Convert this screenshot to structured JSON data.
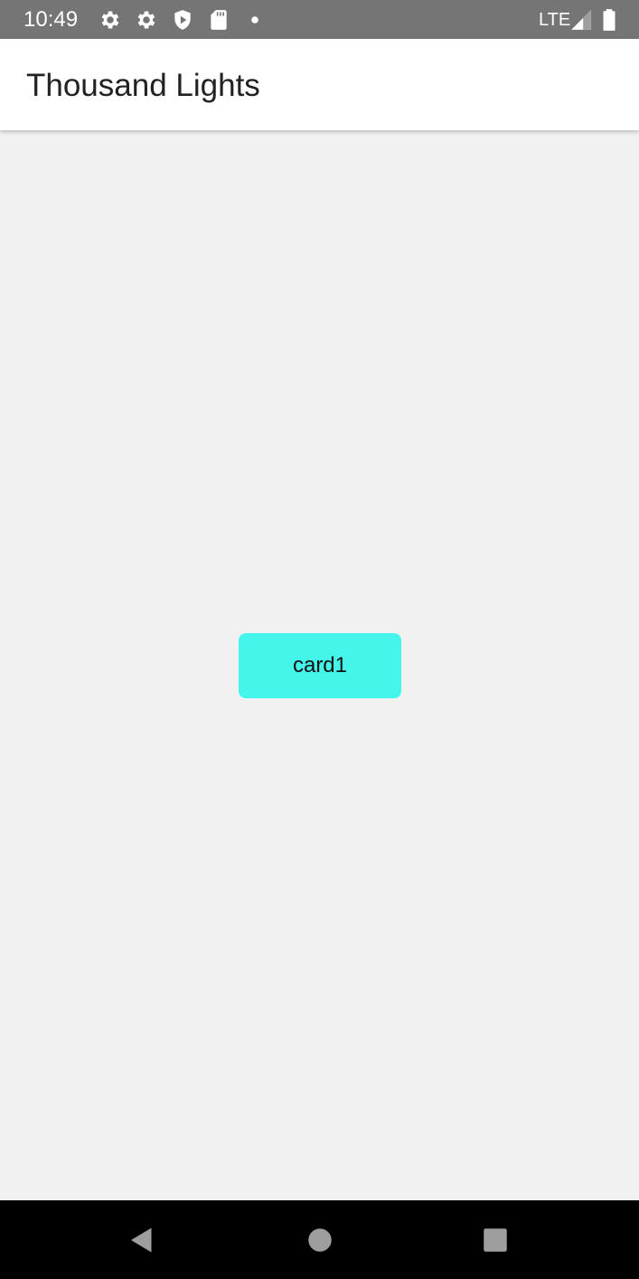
{
  "status_bar": {
    "time": "10:49",
    "network": "LTE",
    "icons": [
      "gear-icon",
      "gear-icon",
      "play-protect-icon",
      "sd-card-icon",
      "notification-dot-icon",
      "signal-icon",
      "battery-icon"
    ]
  },
  "app_bar": {
    "title": "Thousand Lights"
  },
  "main": {
    "cards": [
      {
        "label": "card1",
        "color": "#45f5ea"
      }
    ]
  },
  "nav_bar": {
    "buttons": [
      "back-icon",
      "home-icon",
      "recents-icon"
    ]
  },
  "colors": {
    "background": "#f1f1f1",
    "status_bar": "#757575",
    "app_bar": "#ffffff",
    "nav_bar": "#000000"
  }
}
